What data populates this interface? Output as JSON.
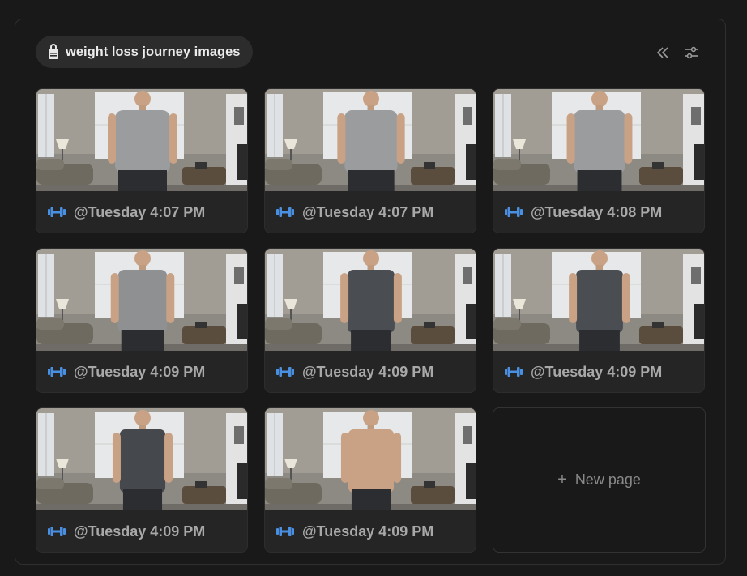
{
  "header": {
    "title": "weight loss journey images",
    "title_icon": "lock-icon",
    "collapse_icon": "double-chevron-left-icon",
    "settings_icon": "sliders-icon"
  },
  "colors": {
    "background": "#191919",
    "card": "#252525",
    "accent_icon": "#4a90e2"
  },
  "cards": [
    {
      "caption": "@Tuesday 4:07 PM",
      "icon": "dumbbell-icon",
      "shirt": "#9b9c9e",
      "body_width": 1.0
    },
    {
      "caption": "@Tuesday 4:07 PM",
      "icon": "dumbbell-icon",
      "shirt": "#9b9c9e",
      "body_width": 0.92
    },
    {
      "caption": "@Tuesday 4:08 PM",
      "icon": "dumbbell-icon",
      "shirt": "#9b9c9e",
      "body_width": 0.85
    },
    {
      "caption": "@Tuesday 4:09 PM",
      "icon": "dumbbell-icon",
      "shirt": "#8f9092",
      "body_width": 0.78
    },
    {
      "caption": "@Tuesday 4:09 PM",
      "icon": "dumbbell-icon",
      "shirt": "#4a4d52",
      "body_width": 0.7
    },
    {
      "caption": "@Tuesday 4:09 PM",
      "icon": "dumbbell-icon",
      "shirt": "#4a4d52",
      "body_width": 0.7
    },
    {
      "caption": "@Tuesday 4:09 PM",
      "icon": "dumbbell-icon",
      "shirt": "#45484c",
      "body_width": 0.65
    },
    {
      "caption": "@Tuesday 4:09 PM",
      "icon": "dumbbell-icon",
      "shirt": "skin",
      "body_width": 0.65
    }
  ],
  "new_page": {
    "label": "New page",
    "icon": "plus-icon"
  }
}
